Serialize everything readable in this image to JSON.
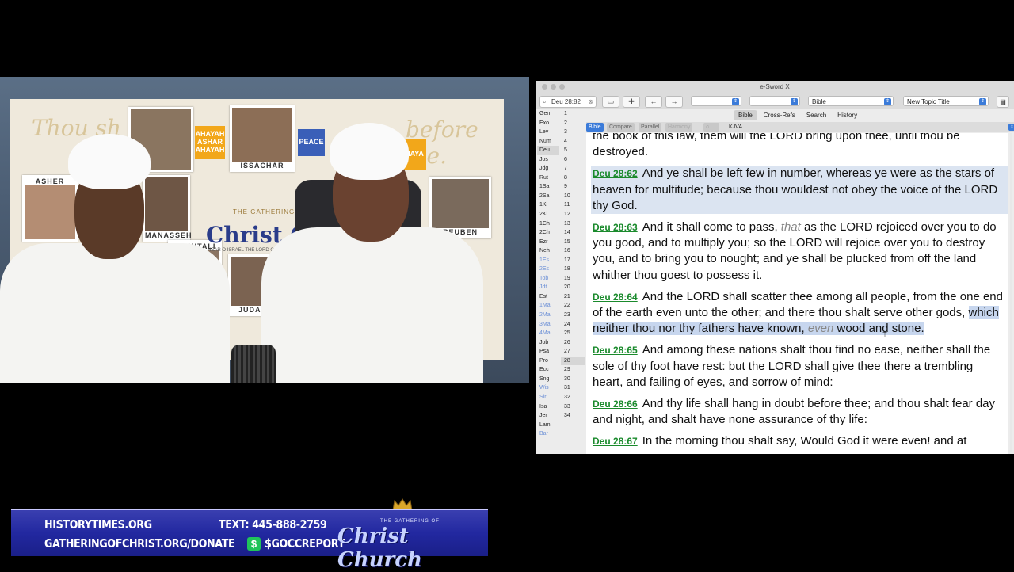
{
  "video": {
    "banner_script_left": "Thou sh",
    "banner_script_right": "before me.",
    "tiles": [
      "AHAYAH ASHAR AHAYAH",
      "PEACE",
      "SHAYA"
    ],
    "photo_captions": [
      "ISSACHAR",
      "ASHER",
      "MANASSEH",
      "REUBEN",
      "NAPHTALI",
      "JUDAH"
    ],
    "logo_sub": "THE GATHERING OF",
    "logo_main": "Christ Chur",
    "logo_tag": "HEAR O ISRAEL THE LORD OUR GOD IS ONE"
  },
  "esword": {
    "window_title": "e-Sword X",
    "search_value": "Deu 28:82",
    "toolbar": {
      "module_select": "Bible",
      "topic_select": "New Topic Title"
    },
    "tabs": [
      {
        "label": "Bible",
        "active": true
      },
      {
        "label": "Cross-Refs",
        "active": false
      },
      {
        "label": "Search",
        "active": false
      },
      {
        "label": "History",
        "active": false
      }
    ],
    "subtabs": {
      "bible": "Bible",
      "compare": "Compare",
      "parallel": "Parallel",
      "harmony": "Harmony",
      "version": "KJVA"
    },
    "books": [
      "Gen",
      "Exo",
      "Lev",
      "Num",
      "Deu",
      "Jos",
      "Jdg",
      "Rut",
      "1Sa",
      "2Sa",
      "1Ki",
      "2Ki",
      "1Ch",
      "2Ch",
      "Ezr",
      "Neh",
      "1Es",
      "2Es",
      "Tob",
      "Jdt",
      "Est",
      "1Ma",
      "2Ma",
      "3Ma",
      "4Ma",
      "Job",
      "Psa",
      "Pro",
      "Ecc",
      "Sng",
      "Wis",
      "Sir",
      "Isa",
      "Jer",
      "Lam",
      "Bar"
    ],
    "apocrypha_books": [
      "1Es",
      "2Es",
      "Tob",
      "Jdt",
      "1Ma",
      "2Ma",
      "3Ma",
      "4Ma",
      "Wis",
      "Sir",
      "Bar"
    ],
    "selected_book": "Deu",
    "chapters": [
      "1",
      "2",
      "3",
      "4",
      "5",
      "6",
      "7",
      "8",
      "9",
      "10",
      "11",
      "12",
      "13",
      "14",
      "15",
      "16",
      "17",
      "18",
      "19",
      "20",
      "21",
      "22",
      "23",
      "24",
      "25",
      "26",
      "27",
      "28",
      "29",
      "30",
      "31",
      "32",
      "33",
      "34"
    ],
    "selected_chapter": "28",
    "verses": [
      {
        "ref": "",
        "text": "the book of this law, them will the LORD bring upon thee, until thou be destroyed."
      },
      {
        "ref": "Deu 28:62",
        "text": "And ye shall be left few in number, whereas ye were as the stars of heaven for multitude; because thou wouldest not obey the voice of the LORD thy God."
      },
      {
        "ref": "Deu 28:63",
        "text_a": "And it shall come to pass,",
        "ital": "that",
        "text_b": "as the LORD rejoiced over you to do you good, and to multiply you; so the LORD will rejoice over you to destroy you, and to bring you to nought; and ye shall be plucked from off the land whither thou goest to possess it."
      },
      {
        "ref": "Deu 28:64",
        "text_a": "And the LORD shall scatter thee among all people, from the one end of the earth even unto the other; and there thou shalt serve other gods,",
        "sel_a": "which neither thou nor thy fathers have known,",
        "ital": "even",
        "sel_b": "wood and stone."
      },
      {
        "ref": "Deu 28:65",
        "text": "And among these nations shalt thou find no ease, neither shall the sole of thy foot have rest: but the LORD shall give thee there a trembling heart, and failing of eyes, and sorrow of mind:"
      },
      {
        "ref": "Deu 28:66",
        "text": "And thy life shall hang in doubt before thee; and thou shalt fear day and night, and shalt have none assurance of thy life:"
      },
      {
        "ref": "Deu 28:67",
        "text": "In the morning thou shalt say, Would God it were even! and at"
      }
    ]
  },
  "lower_third": {
    "line1_left": "HISTORYTIMES.ORG",
    "line1_right": "TEXT: 445-888-2759",
    "line2_left": "GATHERINGOFCHRIST.ORG/DONATE",
    "cash_icon": "$",
    "line2_right": "$GOCCREPORT",
    "logo_small": "THE GATHERING OF",
    "logo": "Christ Church"
  }
}
